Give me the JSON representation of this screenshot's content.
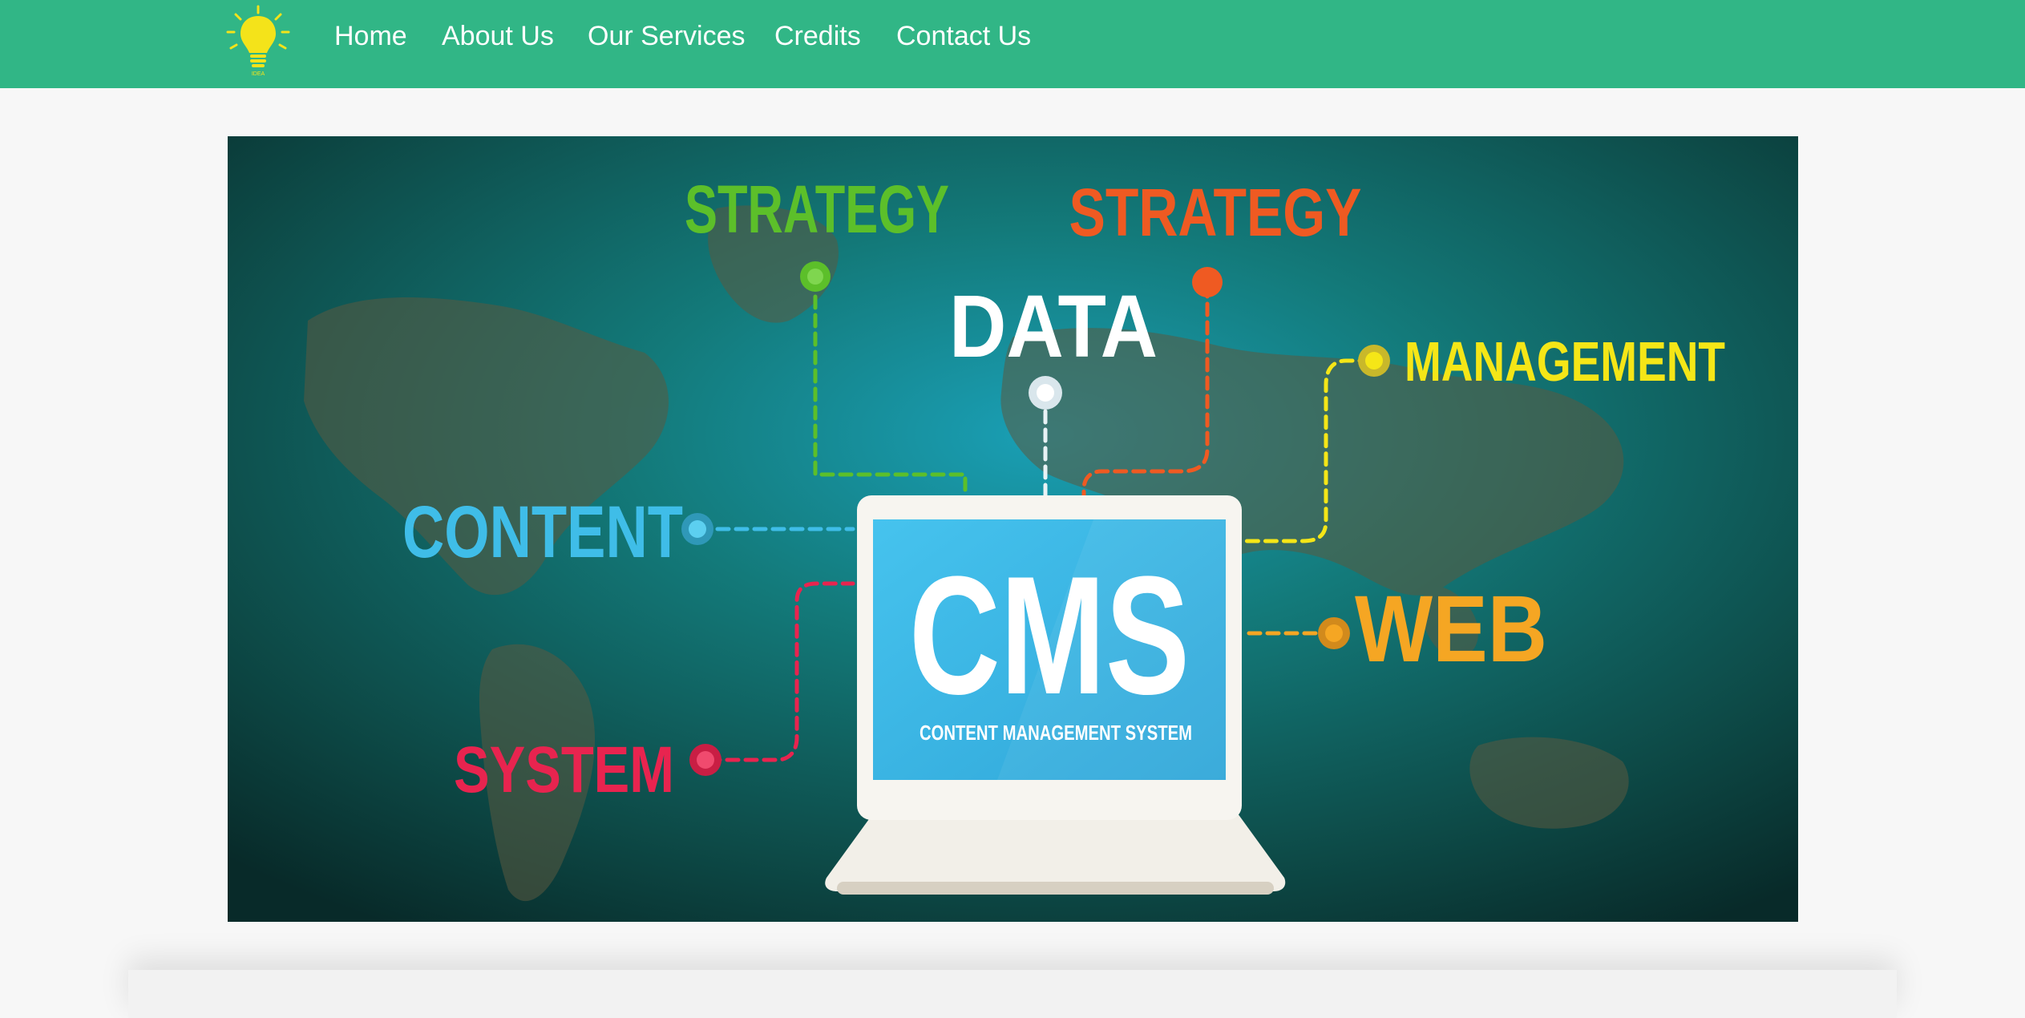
{
  "nav": {
    "logo_caption": "IDEA",
    "items": [
      {
        "label": "Home"
      },
      {
        "label": "About Us"
      },
      {
        "label": "Our Services"
      },
      {
        "label": "Credits"
      },
      {
        "label": "Contact Us"
      }
    ]
  },
  "hero": {
    "labels": {
      "strategy_left": "STRATEGY",
      "strategy_right": "STRATEGY",
      "data": "DATA",
      "management": "MANAGEMENT",
      "content": "CONTENT",
      "web": "WEB",
      "system": "SYSTEM"
    },
    "screen_title": "CMS",
    "screen_subtitle": "CONTENT MANAGEMENT SYSTEM"
  },
  "colors": {
    "navbar": "#31b686",
    "strategy_left": "#5cbf2a",
    "strategy_right": "#ef5a22",
    "data": "#ffffff",
    "management": "#f5e617",
    "content": "#3fbde8",
    "web": "#f5a623",
    "system": "#e8244f",
    "screen": "#3bb4e4"
  }
}
